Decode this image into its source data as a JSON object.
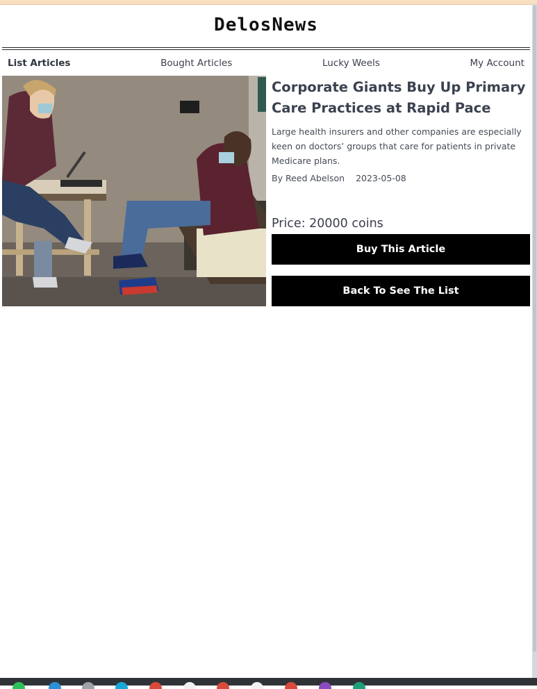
{
  "app": {
    "logo": "DelosNews"
  },
  "nav": {
    "items": [
      {
        "label": "List Articles",
        "active": true
      },
      {
        "label": "Bought Articles",
        "active": false
      },
      {
        "label": "Lucky Weels",
        "active": false
      },
      {
        "label": "My Account",
        "active": false
      }
    ]
  },
  "article": {
    "title": "Corporate Giants Buy Up Primary Care Practices at Rapid Pace",
    "summary": "Large health insurers and other companies are especially keen on doctors’ groups that care for patients in private Medicare plans.",
    "author": "By Reed Abelson",
    "date": "2023-05-08",
    "price": "Price: 20000 coins",
    "buy_label": "Buy This Article",
    "back_label": "Back To See The List"
  },
  "colors": {
    "button_bg": "#000000",
    "button_text": "#ffffff",
    "text": "#3a3f4b"
  }
}
